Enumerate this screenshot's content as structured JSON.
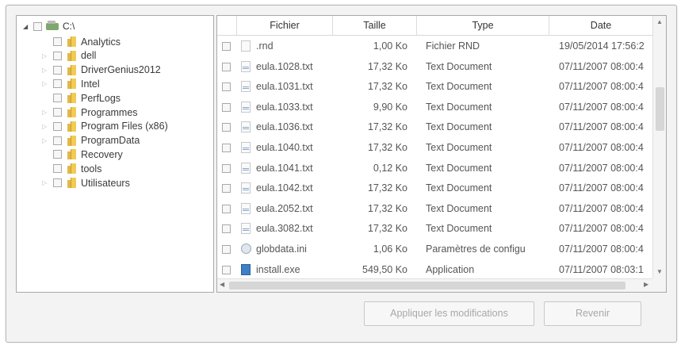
{
  "tree": {
    "root_label": "C:\\",
    "items": [
      {
        "label": "Analytics",
        "expandable": false
      },
      {
        "label": "dell",
        "expandable": true
      },
      {
        "label": "DriverGenius2012",
        "expandable": true
      },
      {
        "label": "Intel",
        "expandable": true
      },
      {
        "label": "PerfLogs",
        "expandable": false
      },
      {
        "label": "Programmes",
        "expandable": true
      },
      {
        "label": "Program Files (x86)",
        "expandable": true
      },
      {
        "label": "ProgramData",
        "expandable": true
      },
      {
        "label": "Recovery",
        "expandable": false
      },
      {
        "label": "tools",
        "expandable": false
      },
      {
        "label": "Utilisateurs",
        "expandable": true
      }
    ]
  },
  "files": {
    "columns": {
      "name": "Fichier",
      "size": "Taille",
      "type": "Type",
      "date": "Date"
    },
    "rows": [
      {
        "name": ".rnd",
        "size": "1,00 Ko",
        "type": "Fichier RND",
        "date": "19/05/2014 17:56:2",
        "icon": "blank-file-icon"
      },
      {
        "name": "eula.1028.txt",
        "size": "17,32 Ko",
        "type": "Text Document",
        "date": "07/11/2007 08:00:4",
        "icon": "text-file-icon"
      },
      {
        "name": "eula.1031.txt",
        "size": "17,32 Ko",
        "type": "Text Document",
        "date": "07/11/2007 08:00:4",
        "icon": "text-file-icon"
      },
      {
        "name": "eula.1033.txt",
        "size": "9,90 Ko",
        "type": "Text Document",
        "date": "07/11/2007 08:00:4",
        "icon": "text-file-icon"
      },
      {
        "name": "eula.1036.txt",
        "size": "17,32 Ko",
        "type": "Text Document",
        "date": "07/11/2007 08:00:4",
        "icon": "text-file-icon"
      },
      {
        "name": "eula.1040.txt",
        "size": "17,32 Ko",
        "type": "Text Document",
        "date": "07/11/2007 08:00:4",
        "icon": "text-file-icon"
      },
      {
        "name": "eula.1041.txt",
        "size": "0,12 Ko",
        "type": "Text Document",
        "date": "07/11/2007 08:00:4",
        "icon": "text-file-icon"
      },
      {
        "name": "eula.1042.txt",
        "size": "17,32 Ko",
        "type": "Text Document",
        "date": "07/11/2007 08:00:4",
        "icon": "text-file-icon"
      },
      {
        "name": "eula.2052.txt",
        "size": "17,32 Ko",
        "type": "Text Document",
        "date": "07/11/2007 08:00:4",
        "icon": "text-file-icon"
      },
      {
        "name": "eula.3082.txt",
        "size": "17,32 Ko",
        "type": "Text Document",
        "date": "07/11/2007 08:00:4",
        "icon": "text-file-icon"
      },
      {
        "name": "globdata.ini",
        "size": "1,06 Ko",
        "type": "Paramètres de configu",
        "date": "07/11/2007 08:00:4",
        "icon": "settings-file-icon"
      },
      {
        "name": "install.exe",
        "size": "549,50 Ko",
        "type": "Application",
        "date": "07/11/2007 08:03:1",
        "icon": "application-icon"
      }
    ]
  },
  "buttons": {
    "apply": "Appliquer les modifications",
    "revert": "Revenir"
  }
}
